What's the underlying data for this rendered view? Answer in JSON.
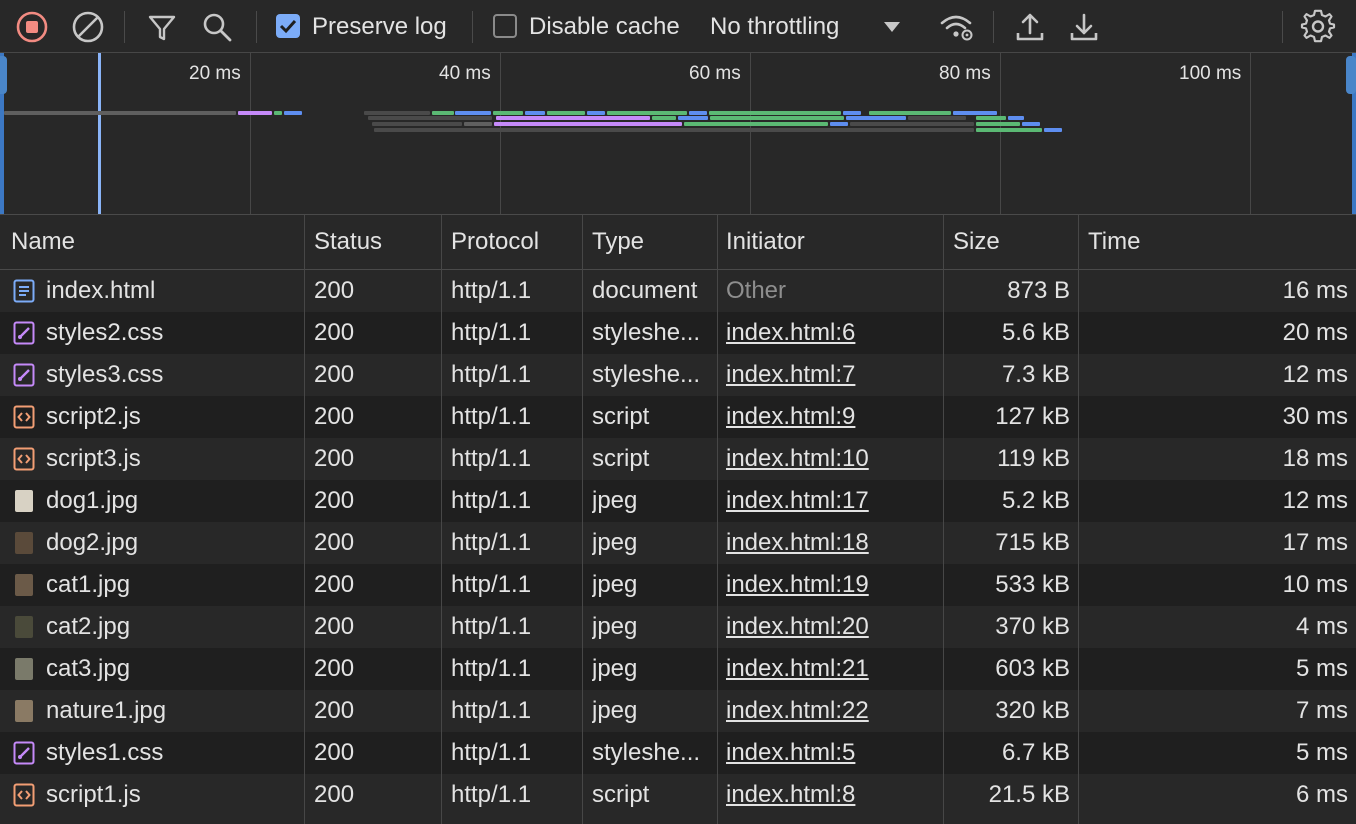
{
  "toolbar": {
    "preserve_log_label": "Preserve log",
    "preserve_log_checked": true,
    "disable_cache_label": "Disable cache",
    "disable_cache_checked": false,
    "throttling_value": "No throttling",
    "icons": [
      "record-stop-icon",
      "clear-icon",
      "filter-icon",
      "search-icon",
      "network-conditions-icon",
      "import-har-icon",
      "export-har-icon",
      "settings-gear-icon"
    ]
  },
  "overview": {
    "ticks": [
      "20 ms",
      "40 ms",
      "60 ms",
      "80 ms",
      "100 ms"
    ]
  },
  "table": {
    "columns": [
      "Name",
      "Status",
      "Protocol",
      "Type",
      "Initiator",
      "Size",
      "Time"
    ],
    "rows": [
      {
        "name": "index.html",
        "icon": "document-icon",
        "status": "200",
        "protocol": "http/1.1",
        "type": "document",
        "initiator": "Other",
        "size": "873 B",
        "time": "16 ms"
      },
      {
        "name": "styles2.css",
        "icon": "stylesheet-icon",
        "status": "200",
        "protocol": "http/1.1",
        "type": "styleshe...",
        "initiator": "index.html:6",
        "size": "5.6 kB",
        "time": "20 ms"
      },
      {
        "name": "styles3.css",
        "icon": "stylesheet-icon",
        "status": "200",
        "protocol": "http/1.1",
        "type": "styleshe...",
        "initiator": "index.html:7",
        "size": "7.3 kB",
        "time": "12 ms"
      },
      {
        "name": "script2.js",
        "icon": "script-icon",
        "status": "200",
        "protocol": "http/1.1",
        "type": "script",
        "initiator": "index.html:9",
        "size": "127 kB",
        "time": "30 ms"
      },
      {
        "name": "script3.js",
        "icon": "script-icon",
        "status": "200",
        "protocol": "http/1.1",
        "type": "script",
        "initiator": "index.html:10",
        "size": "119 kB",
        "time": "18 ms"
      },
      {
        "name": "dog1.jpg",
        "icon": "image-thumbnail-icon",
        "status": "200",
        "protocol": "http/1.1",
        "type": "jpeg",
        "initiator": "index.html:17",
        "size": "5.2 kB",
        "time": "12 ms"
      },
      {
        "name": "dog2.jpg",
        "icon": "image-thumbnail-icon",
        "status": "200",
        "protocol": "http/1.1",
        "type": "jpeg",
        "initiator": "index.html:18",
        "size": "715 kB",
        "time": "17 ms"
      },
      {
        "name": "cat1.jpg",
        "icon": "image-thumbnail-icon",
        "status": "200",
        "protocol": "http/1.1",
        "type": "jpeg",
        "initiator": "index.html:19",
        "size": "533 kB",
        "time": "10 ms"
      },
      {
        "name": "cat2.jpg",
        "icon": "image-thumbnail-icon",
        "status": "200",
        "protocol": "http/1.1",
        "type": "jpeg",
        "initiator": "index.html:20",
        "size": "370 kB",
        "time": "4 ms"
      },
      {
        "name": "cat3.jpg",
        "icon": "image-thumbnail-icon",
        "status": "200",
        "protocol": "http/1.1",
        "type": "jpeg",
        "initiator": "index.html:21",
        "size": "603 kB",
        "time": "5 ms"
      },
      {
        "name": "nature1.jpg",
        "icon": "image-thumbnail-icon",
        "status": "200",
        "protocol": "http/1.1",
        "type": "jpeg",
        "initiator": "index.html:22",
        "size": "320 kB",
        "time": "7 ms"
      },
      {
        "name": "styles1.css",
        "icon": "stylesheet-icon",
        "status": "200",
        "protocol": "http/1.1",
        "type": "styleshe...",
        "initiator": "index.html:5",
        "size": "6.7 kB",
        "time": "5 ms"
      },
      {
        "name": "script1.js",
        "icon": "script-icon",
        "status": "200",
        "protocol": "http/1.1",
        "type": "script",
        "initiator": "index.html:8",
        "size": "21.5 kB",
        "time": "6 ms"
      }
    ]
  },
  "colors": {
    "background": "#282828",
    "row_alt": "#1f1f1f",
    "text": "#e3e3e3",
    "muted": "#8e8e8e",
    "accent_blue": "#7cacf8",
    "record_red": "#f28b82",
    "document_blue": "#7cacf8",
    "stylesheet_purple": "#c58af9",
    "script_orange": "#f29e74",
    "waterfall_green": "#5bb974",
    "waterfall_blue": "#5e8ef0",
    "waterfall_purple": "#c58af9",
    "waterfall_gray": "#5f5f5f"
  }
}
